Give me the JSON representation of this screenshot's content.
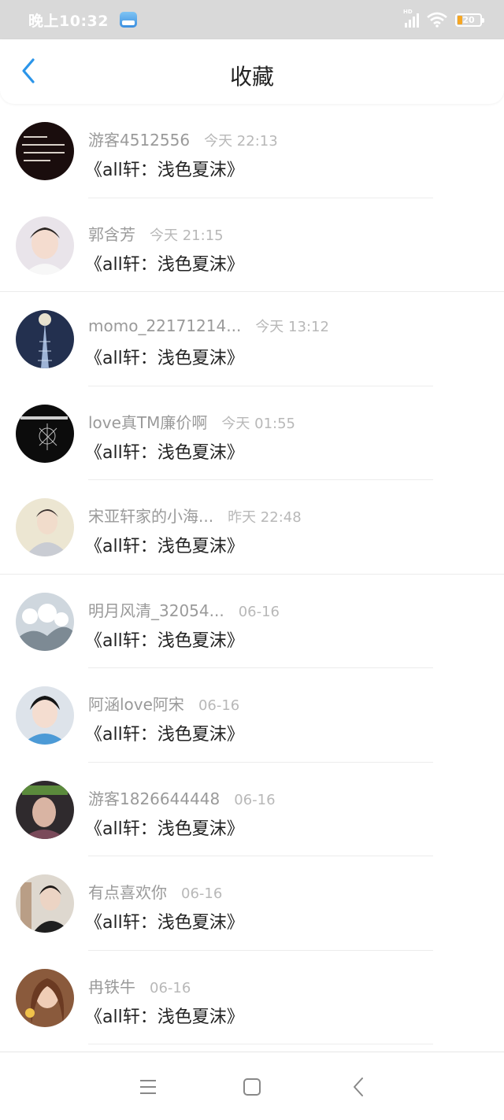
{
  "status_bar": {
    "time": "晚上10:32",
    "signal_label": "HD",
    "battery_level": "20",
    "battery_percent": 20
  },
  "header": {
    "title": "收藏",
    "back_icon": "chevron-left-icon",
    "accent_color": "#2b95e9"
  },
  "items": [
    {
      "user": "游客4512556",
      "time": "今天 22:13",
      "title": "《all轩：浅色夏沫》"
    },
    {
      "user": "郭含芳",
      "time": "今天 21:15",
      "title": "《all轩：浅色夏沫》"
    },
    {
      "user": "momo_22171214...",
      "time": "今天 13:12",
      "title": "《all轩：浅色夏沫》"
    },
    {
      "user": "love真TM廉价啊",
      "time": "今天 01:55",
      "title": "《all轩：浅色夏沫》"
    },
    {
      "user": "宋亚轩家的小海...",
      "time": "昨天 22:48",
      "title": "《all轩：浅色夏沫》"
    },
    {
      "user": "明月风清_32054...",
      "time": "06-16",
      "title": "《all轩：浅色夏沫》"
    },
    {
      "user": "阿涵love阿宋",
      "time": "06-16",
      "title": "《all轩：浅色夏沫》"
    },
    {
      "user": "游客1826644448",
      "time": "06-16",
      "title": "《all轩：浅色夏沫》"
    },
    {
      "user": "有点喜欢你",
      "time": "06-16",
      "title": "《all轩：浅色夏沫》"
    },
    {
      "user": "冉铁牛",
      "time": "06-16",
      "title": "《all轩：浅色夏沫》"
    }
  ],
  "bottom_nav": {
    "menu_icon": "menu-icon",
    "home_icon": "home-square-icon",
    "back_icon": "back-triangle-icon"
  }
}
